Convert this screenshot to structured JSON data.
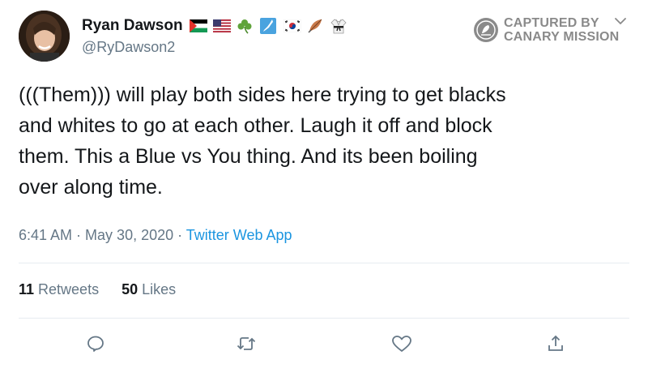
{
  "user": {
    "display_name": "Ryan Dawson",
    "handle": "@RyDawson2",
    "name_emojis": [
      "palestine-flag-icon",
      "us-flag-icon",
      "shamrock-icon",
      "japan-map-icon",
      "south-korea-flag-icon",
      "feather-icon",
      "karate-uniform-icon"
    ]
  },
  "badge": {
    "line1": "CAPTURED BY",
    "line2": "CANARY MISSION"
  },
  "tweet": {
    "text": "(((Them))) will play both sides here trying to get blacks\nand whites to go at each other.  Laugh it off and block\nthem. This a Blue vs You thing. And its been boiling\nover  along time."
  },
  "meta": {
    "time": "6:41 AM",
    "sep1": " · ",
    "date": "May 30, 2020",
    "sep2": " · ",
    "source": "Twitter Web App"
  },
  "stats": {
    "retweets_count": "11",
    "retweets_label": "Retweets",
    "likes_count": "50",
    "likes_label": "Likes"
  },
  "actions": [
    "reply-icon",
    "retweet-icon",
    "like-icon",
    "share-icon"
  ],
  "colors": {
    "text": "#14171a",
    "secondary": "#657786",
    "link": "#1b95e0",
    "divider": "#e6ecf0",
    "badge": "#8a8a8a"
  }
}
